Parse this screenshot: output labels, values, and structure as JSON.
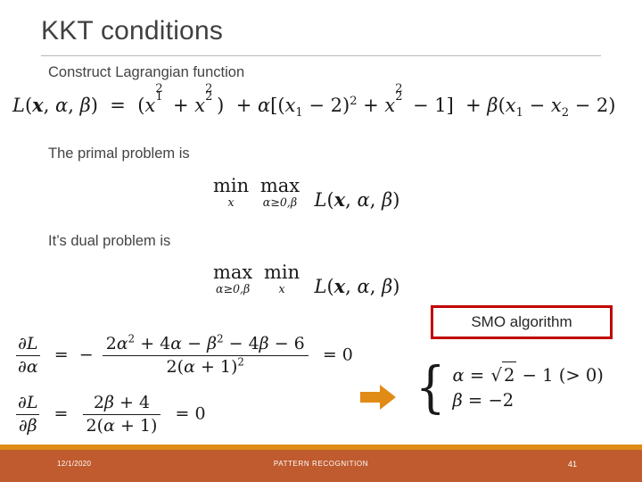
{
  "slide": {
    "title": "KKT conditions",
    "lines": {
      "construct": "Construct Lagrangian function",
      "primal": "The primal problem is",
      "dual": "It’s dual problem is"
    },
    "equations": {
      "lagrangian": {
        "lhs": "L(x, α, β)",
        "rhs": "(x₁² + x₂²) + α[(x₁ − 2)² + x₂² − 1] + β(x₁ − x₂ − 2)",
        "full": "L(x, α, β) = (x₁² + x₂²) + α[(x₁ − 2)² + x₂² − 1] + β(x₁ − x₂ − 2)"
      },
      "primal": {
        "op1": "min",
        "op1_sub": "x",
        "op2": "max",
        "op2_sub": "α≥0,β",
        "body": "L(x, α, β)",
        "full": "min_x max_{α≥0,β} L(x, α, β)"
      },
      "dual": {
        "op1": "max",
        "op1_sub": "α≥0,β",
        "op2": "min",
        "op2_sub": "x",
        "body": "L(x, α, β)",
        "full": "max_{α≥0,β} min_x L(x, α, β)"
      },
      "dL_dalpha": {
        "lhs_num": "∂L",
        "lhs_den": "∂α",
        "sign": "−",
        "num": "2α² + 4α − β² − 4β − 6",
        "den": "2(α + 1)²",
        "rhs": "0",
        "full": "∂L/∂α = − (2α² + 4α − β² − 4β − 6) / (2(α + 1)²) = 0"
      },
      "dL_dbeta": {
        "lhs_num": "∂L",
        "lhs_den": "∂β",
        "num": "2β + 4",
        "den": "2(α + 1)",
        "rhs": "0",
        "full": "∂L/∂β = (2β + 4) / (2(α + 1)) = 0"
      }
    },
    "solution": {
      "alpha": "α = √2 − 1 (> 0)",
      "beta": "β = −2"
    },
    "callout": {
      "label": "SMO algorithm",
      "border_color": "#c00000"
    },
    "arrow": {
      "color": "#e18b17",
      "direction": "right"
    },
    "footer": {
      "date": "12/1/2020",
      "center": "PATTERN RECOGNITION",
      "page": "41",
      "bar_color": "#bf5b2e",
      "stripe_color": "#e18b17"
    }
  }
}
